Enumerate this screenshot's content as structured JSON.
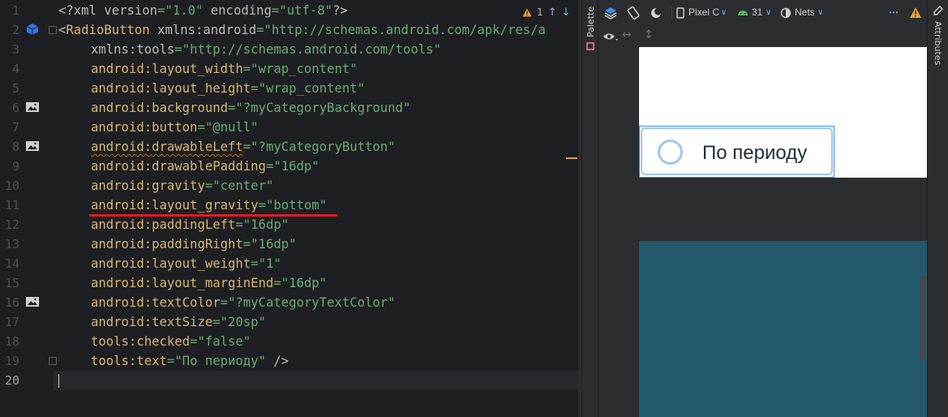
{
  "editor": {
    "line_numbers": [
      "1",
      "2",
      "3",
      "4",
      "5",
      "6",
      "7",
      "8",
      "9",
      "10",
      "11",
      "12",
      "13",
      "14",
      "15",
      "16",
      "17",
      "18",
      "19",
      "20"
    ],
    "warnings_count": "1",
    "lines": {
      "l1": {
        "a": "<?xml ",
        "b": "version",
        "c": "=\"1.0\" ",
        "d": "encoding",
        "e": "=\"utf-8\"",
        "f": "?>"
      },
      "l2": {
        "lt": "<",
        "tag": "RadioButton",
        "sp": " ",
        "ns": "xmlns:",
        "nsn": "android",
        "eq": "=",
        "val": "\"http://schemas.android.com/apk/res/a"
      },
      "l3": {
        "ns": "xmlns:",
        "nsn": "tools",
        "eq": "=",
        "val": "\"http://schemas.android.com/tools\""
      },
      "l4": {
        "ns": "android:",
        "attr": "layout_width",
        "eq": "=",
        "val": "\"wrap_content\""
      },
      "l5": {
        "ns": "android:",
        "attr": "layout_height",
        "eq": "=",
        "val": "\"wrap_content\""
      },
      "l6": {
        "ns": "android:",
        "attr": "background",
        "eq": "=",
        "val": "\"?myCategoryBackground\""
      },
      "l7": {
        "ns": "android:",
        "attr": "button",
        "eq": "=",
        "val": "\"@null\""
      },
      "l8": {
        "ns": "android:",
        "attr": "drawableLeft",
        "eq": "=",
        "val": "\"?myCategoryButton\""
      },
      "l9": {
        "ns": "android:",
        "attr": "drawablePadding",
        "eq": "=",
        "val": "\"16dp\""
      },
      "l10": {
        "ns": "android:",
        "attr": "gravity",
        "eq": "=",
        "val": "\"center\""
      },
      "l11": {
        "ns": "android:",
        "attr": "layout_gravity",
        "eq": "=",
        "val": "\"bottom\""
      },
      "l12": {
        "ns": "android:",
        "attr": "paddingLeft",
        "eq": "=",
        "val": "\"16dp\""
      },
      "l13": {
        "ns": "android:",
        "attr": "paddingRight",
        "eq": "=",
        "val": "\"16dp\""
      },
      "l14": {
        "ns": "android:",
        "attr": "layout_weight",
        "eq": "=",
        "val": "\"1\""
      },
      "l15": {
        "ns": "android:",
        "attr": "layout_marginEnd",
        "eq": "=",
        "val": "\"16dp\""
      },
      "l16": {
        "ns": "android:",
        "attr": "textColor",
        "eq": "=",
        "val": "\"?myCategoryTextColor\""
      },
      "l17": {
        "ns": "android:",
        "attr": "textSize",
        "eq": "=",
        "val": "\"20sp\""
      },
      "l18": {
        "ns": "tools:",
        "attr": "checked",
        "eq": "=",
        "val": "\"false\""
      },
      "l19": {
        "ns": "tools:",
        "attr": "text",
        "eq": "=",
        "val": "\"По периоду\"",
        "close": " />"
      }
    }
  },
  "tool_windows": {
    "palette": "Palette",
    "attributes": "Attributes"
  },
  "design_toolbar": {
    "device": "Pixel C",
    "api_level": "31",
    "theme": "Nets",
    "more": "⋯"
  },
  "preview": {
    "radio_text": "По периоду"
  },
  "colors": {
    "editor_bg": "#1e1f22",
    "tag": "#d5b778",
    "string": "#6aab73",
    "accent_blue": "#3d8fe0",
    "error_underline": "#e01b24",
    "preview_teal": "#225a6b"
  }
}
